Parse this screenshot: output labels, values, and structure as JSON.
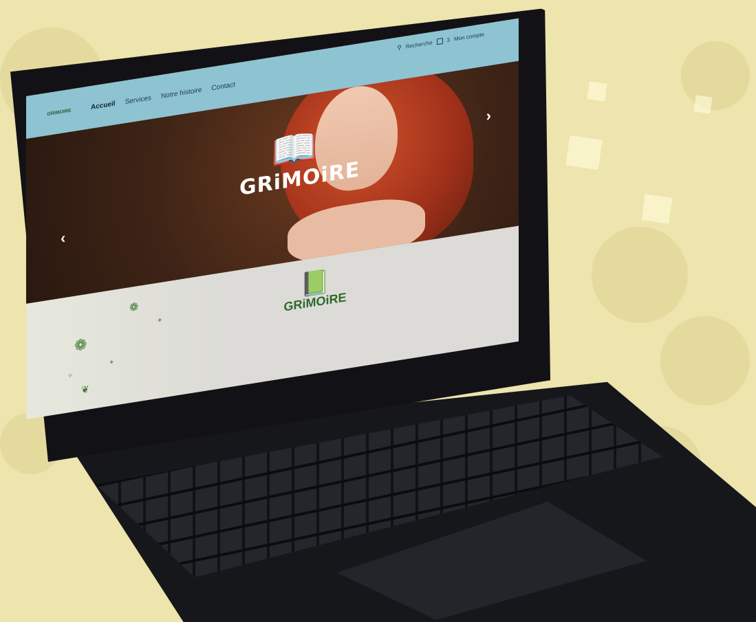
{
  "site": {
    "logo_text": "GRIMOIRE",
    "nav": [
      {
        "label": "Accueil",
        "active": true
      },
      {
        "label": "Services",
        "active": false
      },
      {
        "label": "Notre histoire",
        "active": false
      },
      {
        "label": "Contact",
        "active": false
      }
    ],
    "search_label": "Recherche",
    "cart_count": "3",
    "account_label": "Mon compte"
  },
  "hero": {
    "logo_text": "GRiMOiRE"
  },
  "section": {
    "logo_text": "GRiMOiRE"
  },
  "icons": {
    "search": "search-icon",
    "cart": "cart-icon",
    "prev": "chevron-left-icon",
    "next": "chevron-right-icon"
  },
  "colors": {
    "background": "#ede4ae",
    "header": "#8ec3d2",
    "brand_green": "#2d6a2a"
  }
}
